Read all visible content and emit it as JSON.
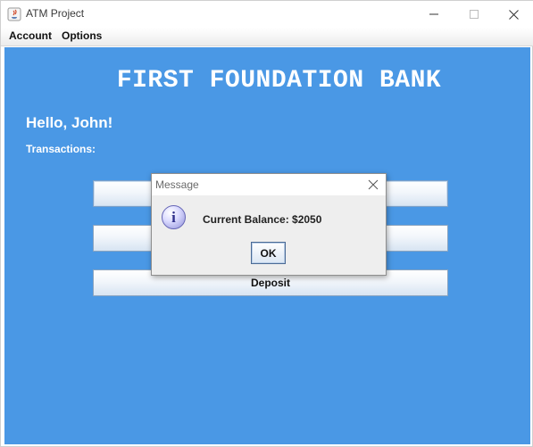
{
  "window": {
    "title": "ATM Project",
    "controls": {
      "minimize": "minimize-icon",
      "maximize": "maximize-icon",
      "close": "close-icon"
    }
  },
  "menubar": {
    "items": [
      {
        "label": "Account"
      },
      {
        "label": "Options"
      }
    ]
  },
  "main": {
    "bank_name": "FIRST FOUNDATION BANK",
    "greeting": "Hello, John!",
    "transactions_label": "Transactions:",
    "buttons": [
      {
        "label": ""
      },
      {
        "label": ""
      },
      {
        "label": "Deposit"
      }
    ],
    "background_color": "#4a98e5"
  },
  "dialog": {
    "title": "Message",
    "icon": "info-icon",
    "icon_glyph": "i",
    "message": "Current Balance: $2050",
    "ok_label": "OK"
  }
}
